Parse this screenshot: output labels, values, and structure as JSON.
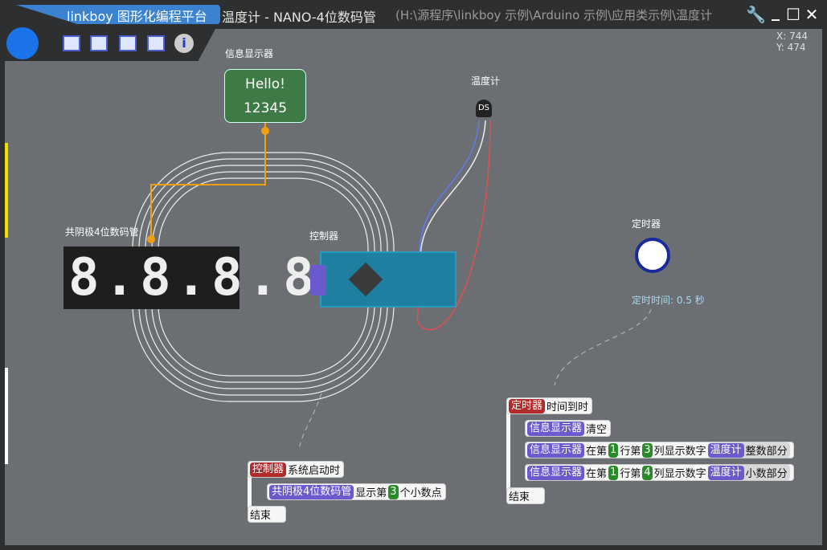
{
  "app": {
    "brand": "linkboy 图形化编程平台",
    "title": "温度计 - NANO-4位数码管",
    "path": "(H:\\源程序\\linkboy 示例\\Arduino 示例\\应用类示例\\温度计"
  },
  "window": {
    "settings": "🔧",
    "minimize": "_",
    "maximize": "☐",
    "close": "✕"
  },
  "toolbar": [
    "new-icon",
    "open-icon",
    "folder-icon",
    "export-icon",
    "info-icon"
  ],
  "coords": {
    "x": "X: 744",
    "y": "Y: 474"
  },
  "components": {
    "lcd": {
      "label": "信息显示器",
      "line1": "Hello!",
      "line2": "12345"
    },
    "sensor": {
      "label": "温度计",
      "chip": "DS"
    },
    "segment": {
      "label": "共阴极4位数码管",
      "digits": "8.8.8.8."
    },
    "controller": {
      "label": "控制器"
    },
    "timer": {
      "label": "定时器",
      "setting": "定时时间: 0.5 秒"
    }
  },
  "program": {
    "start": {
      "head": "控制器",
      "event": "系统启动时",
      "stmt_tag": "共阴极4位数码管",
      "stmt_a": "显示第",
      "stmt_num": "3",
      "stmt_b": "个小数点",
      "end": "结束"
    },
    "timer": {
      "head": "定时器",
      "event": "时间到时",
      "s1_tag": "信息显示器",
      "s1": "清空",
      "s2_tag": "信息显示器",
      "s2_a": "在第",
      "s2_n1": "1",
      "s2_b": "行第",
      "s2_n2": "3",
      "s2_c": "列显示数字",
      "s2_src": "温度计",
      "s2_prop": "整数部分",
      "s3_tag": "信息显示器",
      "s3_a": "在第",
      "s3_n1": "1",
      "s3_b": "行第",
      "s3_n2": "4",
      "s3_c": "列显示数字",
      "s3_src": "温度计",
      "s3_prop": "小数部分",
      "end": "结束"
    }
  }
}
